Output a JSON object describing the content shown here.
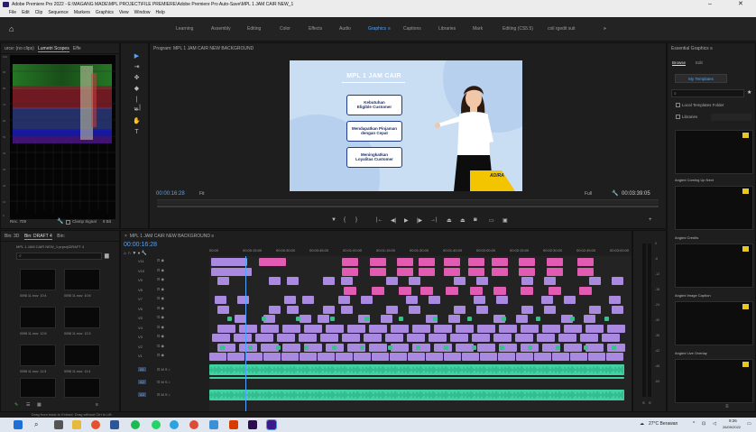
{
  "window": {
    "title": "Adobe Premiere Pro 2022 - E:\\MAGANG MADE\\MPL PROJECT\\FILE PREMIERE\\Adobe Premiere Pro Auto-Save\\MPL 1 JAM CAIR NEW_1",
    "minimize": "–",
    "close": "✕"
  },
  "menu": [
    "File",
    "Edit",
    "Clip",
    "Sequence",
    "Markers",
    "Graphics",
    "View",
    "Window",
    "Help"
  ],
  "workspaces": {
    "tabs": [
      "Learning",
      "Assembly",
      "Editing",
      "Color",
      "Effects",
      "Audio",
      "Graphics",
      "Captions",
      "Libraries",
      "Mark",
      "Editing (CS5.5)",
      "coil rgedit suit"
    ],
    "active": "Graphics",
    "more": "»"
  },
  "scopes": {
    "tabs": [
      "urce: (no clips)",
      "Lumetri Scopes",
      "Effe"
    ],
    "footer_left": "Rec. 709",
    "clamp_label": "Clamp Signal",
    "bit_depth": "8 Bit",
    "axis": [
      "100",
      "90",
      "80",
      "70",
      "60",
      "50",
      "40",
      "30",
      "20",
      "10",
      "0"
    ]
  },
  "program": {
    "title": "Program: MPL 1 JAM CAIR NEW BACKGROUND",
    "timecode_in": "00:00:16:28",
    "fit": "Fit",
    "quality": "Full",
    "timecode_out": "00:03:39:05",
    "video": {
      "headline": "MPL 1 JAM CAIR",
      "cards": [
        "Kebutuhan\nEligible Customer",
        "Mendapatkan Pinjaman\ndengan Cepat",
        "Meningkatkan\nLoyalitas Customer"
      ],
      "brand": "ADIRA"
    }
  },
  "essential": {
    "title": "Essential Graphics",
    "tabs": [
      "Browse",
      "Edit"
    ],
    "my_templates": "My Templates",
    "local_folder": "Local Templates Folder",
    "libraries": "Libraries",
    "templates": [
      "Angled Coming Up Next",
      "Angled Credits",
      "Angled Image Caption",
      "Angled Live Overlay"
    ]
  },
  "project": {
    "tabs": [
      "Bin: 3D",
      "Bin: DRAFT 4",
      "Bin:"
    ],
    "path": "MPL 1 JAM CAIR NEW_1.prproj\\DRAFT 4",
    "items": [
      {
        "name": "0098 11.mov",
        "dur": "10:4"
      },
      {
        "name": "0098 11.mov",
        "dur": "10:8"
      },
      {
        "name": "0098 11.mov",
        "dur": "12:6"
      },
      {
        "name": "0098 11.mov",
        "dur": "12:3"
      },
      {
        "name": "0098 11.mov",
        "dur": "11:5"
      },
      {
        "name": "0098 11.mov",
        "dur": "11:4"
      }
    ]
  },
  "timeline": {
    "title": "MPL 1 JAM CAIR NEW BACKGROUND",
    "timecode": "00:00:16:28",
    "ruler": [
      "00:00",
      "00:00:15:00",
      "00:00:30:00",
      "00:00:45:00",
      "00:01:00:00",
      "00:01:15:00",
      "00:01:30:00",
      "00:01:45:00",
      "00:02:00:00",
      "00:02:15:00",
      "00:02:30:00",
      "00:02:45:00",
      "00:03:00:00"
    ],
    "video_tracks": [
      "V11",
      "V10",
      "V9",
      "V8",
      "V7",
      "V6",
      "V5",
      "V4",
      "V3",
      "V2",
      "V1"
    ],
    "audio_tracks": [
      "A1",
      "A2",
      "A3"
    ],
    "clip_labels": [
      "LOGO ADIRA",
      "LOGO ADIRA",
      "opening",
      "bg"
    ],
    "meters": [
      "0",
      "-6",
      "-12",
      "-18",
      "-24",
      "-30",
      "-36",
      "-42",
      "-48",
      "-54"
    ],
    "meter_footer": [
      "S",
      "S"
    ]
  },
  "status": "Drag from track to Extract. Drag without Ctrl to Lift.",
  "taskbar": {
    "weather": "27°C Berawan",
    "time": "9:26",
    "date": "26/09/2022"
  },
  "colors": {
    "accent": "#4ea4ff",
    "clip_pink": "#e25bb2",
    "clip_purple": "#a98ae0",
    "clip_green": "#38c28a",
    "audio_green": "#3fd3a3"
  }
}
